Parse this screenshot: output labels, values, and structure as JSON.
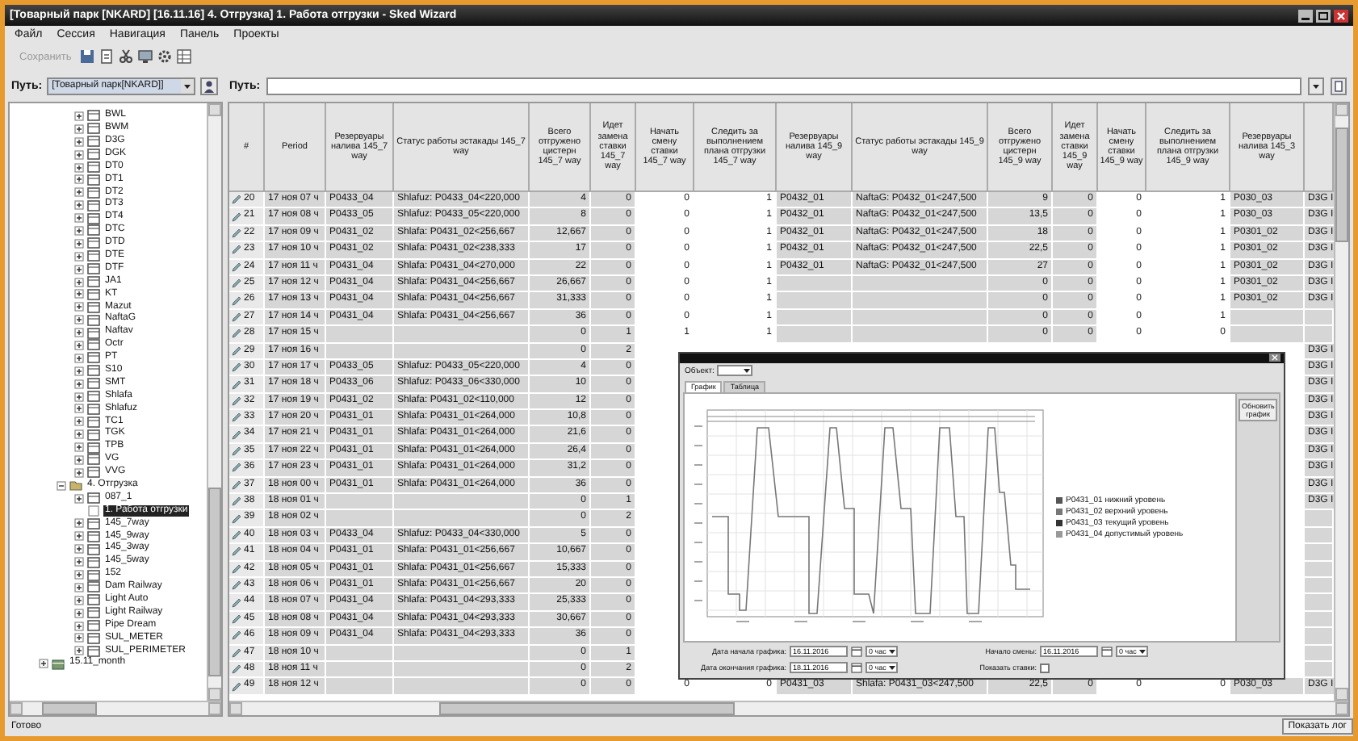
{
  "window": {
    "title": "[Товарный парк [NKARD] [16.11.16] 4. Отгрузка] 1. Работа отгрузки - Sked Wizard"
  },
  "menu": [
    "Файл",
    "Сессия",
    "Навигация",
    "Панель",
    "Проекты"
  ],
  "toolbar": {
    "save": {
      "label": "Сохранить",
      "disabled": true
    }
  },
  "left_path": {
    "label": "Путь:",
    "value": "[Товарный парк[NKARD]]"
  },
  "right_path": {
    "label": "Путь:"
  },
  "tree": [
    {
      "kind": "continued",
      "children": [
        {
          "kind": "continued",
          "children": [
            {
              "label": "BWL",
              "kind": "table",
              "expanded": false,
              "selected": false
            },
            {
              "label": "BWM",
              "kind": "table",
              "expanded": false,
              "selected": false
            },
            {
              "label": "D3G",
              "kind": "table",
              "expanded": false,
              "selected": false
            },
            {
              "label": "DGK",
              "kind": "table",
              "expanded": false,
              "selected": false
            },
            {
              "label": "DT0",
              "kind": "table",
              "expanded": false,
              "selected": false
            },
            {
              "label": "DT1",
              "kind": "table",
              "expanded": false,
              "selected": false
            },
            {
              "label": "DT2",
              "kind": "table",
              "expanded": false,
              "selected": false
            },
            {
              "label": "DT3",
              "kind": "table",
              "expanded": false,
              "selected": false
            },
            {
              "label": "DT4",
              "kind": "table",
              "expanded": false,
              "selected": false
            },
            {
              "label": "DTC",
              "kind": "table",
              "expanded": false,
              "selected": false
            },
            {
              "label": "DTD",
              "kind": "table",
              "expanded": false,
              "selected": false
            },
            {
              "label": "DTE",
              "kind": "table",
              "expanded": false,
              "selected": false
            },
            {
              "label": "DTF",
              "kind": "table",
              "expanded": false,
              "selected": false
            },
            {
              "label": "JA1",
              "kind": "table",
              "expanded": false,
              "selected": false
            },
            {
              "label": "KT",
              "kind": "table",
              "expanded": false,
              "selected": false
            },
            {
              "label": "Mazut",
              "kind": "table",
              "expanded": false,
              "selected": false
            },
            {
              "label": "NaftaG",
              "kind": "table",
              "expanded": false,
              "selected": false
            },
            {
              "label": "Naftav",
              "kind": "table",
              "expanded": false,
              "selected": false
            },
            {
              "label": "Octr",
              "kind": "table",
              "expanded": false,
              "selected": false
            },
            {
              "label": "PT",
              "kind": "table",
              "expanded": false,
              "selected": false
            },
            {
              "label": "S10",
              "kind": "table",
              "expanded": false,
              "selected": false
            },
            {
              "label": "SMT",
              "kind": "table",
              "expanded": false,
              "selected": false
            },
            {
              "label": "Shlafa",
              "kind": "table",
              "expanded": false,
              "selected": false
            },
            {
              "label": "Shlafuz",
              "kind": "table",
              "expanded": false,
              "selected": false
            },
            {
              "label": "TC1",
              "kind": "table",
              "expanded": false,
              "selected": false
            },
            {
              "label": "TGK",
              "kind": "table",
              "expanded": false,
              "selected": false
            },
            {
              "label": "TPB",
              "kind": "table",
              "expanded": false,
              "selected": false
            },
            {
              "label": "VG",
              "kind": "table",
              "expanded": false,
              "selected": false
            },
            {
              "label": "VVG",
              "kind": "table",
              "expanded": false,
              "selected": false
            }
          ]
        },
        {
          "label": "4. Отгрузка",
          "kind": "folder",
          "expanded": true,
          "selected": false,
          "children": [
            {
              "label": "087_1",
              "kind": "table",
              "expanded": false,
              "selected": false
            },
            {
              "label": "1. Работа отгрузки",
              "kind": "report",
              "selected": true
            },
            {
              "label": "145_7way",
              "kind": "table",
              "expanded": false,
              "selected": false
            },
            {
              "label": "145_9way",
              "kind": "table",
              "expanded": false,
              "selected": false
            },
            {
              "label": "145_3way",
              "kind": "table",
              "expanded": false,
              "selected": false
            },
            {
              "label": "145_5way",
              "kind": "table",
              "expanded": false,
              "selected": false
            },
            {
              "label": "152",
              "kind": "table",
              "expanded": false,
              "selected": false
            },
            {
              "label": "Dam Railway",
              "kind": "table",
              "expanded": false,
              "selected": false
            },
            {
              "label": "Light Auto",
              "kind": "table",
              "expanded": false,
              "selected": false
            },
            {
              "label": "Light Railway",
              "kind": "table",
              "expanded": false,
              "selected": false
            },
            {
              "label": "Pipe Dream",
              "kind": "table",
              "expanded": false,
              "selected": false
            },
            {
              "label": "SUL_METER",
              "kind": "table",
              "expanded": false,
              "selected": false
            },
            {
              "label": "SUL_PERIMETER",
              "kind": "table",
              "expanded": false,
              "selected": false
            }
          ]
        }
      ]
    },
    {
      "label": "15.11_month",
      "kind": "month",
      "expanded": false,
      "selected": false
    }
  ],
  "table": {
    "columns": [
      "#",
      "Period",
      "Резервуары налива 145_7 way",
      "Статус работы эстакады 145_7 way",
      "Всего отгружено цистерн 145_7 way",
      "Идет замена ставки 145_7 way",
      "Начать смену ставки 145_7 way",
      "Следить за выполнением плана отгрузки 145_7 way",
      "Резервуары налива 145_9 way",
      "Статус работы эстакады 145_9 way",
      "Всего отгружено цистерн 145_9 way",
      "Идет замена ставки 145_9 way",
      "Начать смену ставки 145_9 way",
      "Следить за выполнением плана отгрузки 145_9 way",
      "Резервуары налива 145_3 way"
    ],
    "rows": [
      {
        "cells": [
          "20",
          "17 ноя 07 ч",
          "P0433_04",
          "Shlafuz: P0433_04<220,000",
          "4",
          "0",
          "0",
          "1",
          "P0432_01",
          "NaftaG: P0432_01<247,500",
          "9",
          "0",
          "0",
          "1",
          "P030_03",
          "D3G I"
        ]
      },
      {
        "cells": [
          "21",
          "17 ноя 08 ч",
          "P0433_05",
          "Shlafuz: P0433_05<220,000",
          "8",
          "0",
          "0",
          "1",
          "P0432_01",
          "NaftaG: P0432_01<247,500",
          "13,5",
          "0",
          "0",
          "1",
          "P030_03",
          "D3G I"
        ]
      },
      {
        "cells": [
          "22",
          "17 ноя 09 ч",
          "P0431_02",
          "Shlafa: P0431_02<256,667",
          "12,667",
          "0",
          "0",
          "1",
          "P0432_01",
          "NaftaG: P0432_01<247,500",
          "18",
          "0",
          "0",
          "1",
          "P0301_02",
          "D3G I"
        ]
      },
      {
        "cells": [
          "23",
          "17 ноя 10 ч",
          "P0431_02",
          "Shlafa: P0431_02<238,333",
          "17",
          "0",
          "0",
          "1",
          "P0432_01",
          "NaftaG: P0432_01<247,500",
          "22,5",
          "0",
          "0",
          "1",
          "P0301_02",
          "D3G I"
        ]
      },
      {
        "cells": [
          "24",
          "17 ноя 11 ч",
          "P0431_04",
          "Shlafa: P0431_04<270,000",
          "22",
          "0",
          "0",
          "1",
          "P0432_01",
          "NaftaG: P0432_01<247,500",
          "27",
          "0",
          "0",
          "1",
          "P0301_02",
          "D3G I"
        ]
      },
      {
        "cells": [
          "25",
          "17 ноя 12 ч",
          "P0431_04",
          "Shlafa: P0431_04<256,667",
          "26,667",
          "0",
          "0",
          "1",
          null,
          null,
          "0",
          "0",
          "0",
          "1",
          "P0301_02",
          "D3G I"
        ]
      },
      {
        "cells": [
          "26",
          "17 ноя 13 ч",
          "P0431_04",
          "Shlafa: P0431_04<256,667",
          "31,333",
          "0",
          "0",
          "1",
          null,
          null,
          "0",
          "0",
          "0",
          "1",
          "P0301_02",
          "D3G I"
        ]
      },
      {
        "cells": [
          "27",
          "17 ноя 14 ч",
          "P0431_04",
          "Shlafa: P0431_04<256,667",
          "36",
          "0",
          "0",
          "1",
          null,
          null,
          "0",
          "0",
          "0",
          "1",
          null,
          null
        ]
      },
      {
        "cells": [
          "28",
          "17 ноя 15 ч",
          null,
          null,
          "0",
          "1",
          "1",
          "1",
          null,
          null,
          "0",
          "0",
          "0",
          "0",
          null,
          null
        ]
      },
      {
        "cells": [
          "29",
          "17 ноя 16 ч",
          null,
          null,
          "0",
          "2",
          null,
          null,
          null,
          null,
          null,
          null,
          null,
          null,
          null,
          "D3G I"
        ]
      },
      {
        "cells": [
          "30",
          "17 ноя 17 ч",
          "P0433_05",
          "Shlafuz: P0433_05<220,000",
          "4",
          "0",
          null,
          null,
          null,
          null,
          null,
          null,
          null,
          null,
          null,
          "D3G I"
        ]
      },
      {
        "cells": [
          "31",
          "17 ноя 18 ч",
          "P0433_06",
          "Shlafuz: P0433_06<330,000",
          "10",
          "0",
          null,
          null,
          null,
          null,
          null,
          null,
          null,
          null,
          null,
          "D3G I"
        ]
      },
      {
        "cells": [
          "32",
          "17 ноя 19 ч",
          "P0431_02",
          "Shlafa: P0431_02<110,000",
          "12",
          "0",
          null,
          null,
          null,
          null,
          null,
          null,
          null,
          null,
          null,
          "D3G I"
        ]
      },
      {
        "cells": [
          "33",
          "17 ноя 20 ч",
          "P0431_01",
          "Shlafa: P0431_01<264,000",
          "10,8",
          "0",
          null,
          null,
          null,
          null,
          null,
          null,
          null,
          null,
          null,
          "D3G I"
        ]
      },
      {
        "cells": [
          "34",
          "17 ноя 21 ч",
          "P0431_01",
          "Shlafa: P0431_01<264,000",
          "21,6",
          "0",
          null,
          null,
          null,
          null,
          null,
          null,
          null,
          null,
          null,
          "D3G I"
        ]
      },
      {
        "cells": [
          "35",
          "17 ноя 22 ч",
          "P0431_01",
          "Shlafa: P0431_01<264,000",
          "26,4",
          "0",
          null,
          null,
          null,
          null,
          null,
          null,
          null,
          null,
          null,
          "D3G I"
        ]
      },
      {
        "cells": [
          "36",
          "17 ноя 23 ч",
          "P0431_01",
          "Shlafa: P0431_01<264,000",
          "31,2",
          "0",
          null,
          null,
          null,
          null,
          null,
          null,
          null,
          null,
          null,
          "D3G I"
        ]
      },
      {
        "cells": [
          "37",
          "18 ноя 00 ч",
          "P0431_01",
          "Shlafa: P0431_01<264,000",
          "36",
          "0",
          null,
          null,
          null,
          null,
          null,
          null,
          null,
          null,
          null,
          "D3G I"
        ]
      },
      {
        "cells": [
          "38",
          "18 ноя 01 ч",
          null,
          null,
          "0",
          "1",
          null,
          null,
          null,
          null,
          null,
          null,
          null,
          null,
          null,
          "D3G I"
        ]
      },
      {
        "cells": [
          "39",
          "18 ноя 02 ч",
          null,
          null,
          "0",
          "2"
        ]
      },
      {
        "cells": [
          "40",
          "18 ноя 03 ч",
          "P0433_04",
          "Shlafuz: P0433_04<330,000",
          "5",
          "0"
        ]
      },
      {
        "cells": [
          "41",
          "18 ноя 04 ч",
          "P0431_01",
          "Shlafa: P0431_01<256,667",
          "10,667",
          "0"
        ]
      },
      {
        "cells": [
          "42",
          "18 ноя 05 ч",
          "P0431_01",
          "Shlafa: P0431_01<256,667",
          "15,333",
          "0"
        ]
      },
      {
        "cells": [
          "43",
          "18 ноя 06 ч",
          "P0431_01",
          "Shlafa: P0431_01<256,667",
          "20",
          "0"
        ]
      },
      {
        "cells": [
          "44",
          "18 ноя 07 ч",
          "P0431_04",
          "Shlafa: P0431_04<293,333",
          "25,333",
          "0"
        ]
      },
      {
        "cells": [
          "45",
          "18 ноя 08 ч",
          "P0431_04",
          "Shlafa: P0431_04<293,333",
          "30,667",
          "0"
        ]
      },
      {
        "cells": [
          "46",
          "18 ноя 09 ч",
          "P0431_04",
          "Shlafa: P0431_04<293,333",
          "36",
          "0"
        ]
      },
      {
        "cells": [
          "47",
          "18 ноя 10 ч",
          null,
          null,
          "0",
          "1"
        ]
      },
      {
        "cells": [
          "48",
          "18 ноя 11 ч",
          null,
          null,
          "0",
          "2"
        ]
      },
      {
        "cells": [
          "49",
          "18 ноя 12 ч",
          null,
          null,
          "0",
          "0",
          "0",
          "0",
          "P0431_03",
          "Shlafa: P0431_03<247,500",
          "22,5",
          "0",
          "0",
          "0",
          "P030_03",
          "D3G I"
        ]
      }
    ]
  },
  "chart_window": {
    "object_label": "Объект:",
    "tabs": [
      {
        "label": "График",
        "selected": true
      },
      {
        "label": "Таблица",
        "selected": false
      }
    ],
    "refresh_button": "Обновить график",
    "legend": [
      {
        "label": "P0431_01 нижний уровень",
        "color": "#555555"
      },
      {
        "label": "P0431_02 верхний уровень",
        "color": "#777777"
      },
      {
        "label": "P0431_03 текущий уровень",
        "color": "#333333"
      },
      {
        "label": "P0431_04 допустимый уровень",
        "color": "#999999"
      }
    ],
    "controls": [
      {
        "label": "Дата начала графика:",
        "date": "16.11.2016",
        "hour": "0 час"
      },
      {
        "label": "Дата окончания графика:",
        "date": "18.11.2016",
        "hour": "0 час"
      }
    ],
    "shift": {
      "label": "Начало смены:",
      "date": "16.11.2016",
      "hour": "0 час"
    },
    "show_rates": {
      "label": "Показать ставки:",
      "checked": false
    }
  },
  "status_bar": {
    "text": "Готово",
    "button": "Показать лог"
  }
}
